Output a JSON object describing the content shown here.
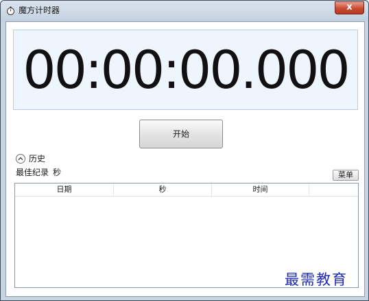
{
  "window": {
    "title": "魔方计时器",
    "close_symbol": "x"
  },
  "timer": {
    "display": "00:00:00.000"
  },
  "controls": {
    "start_label": "开始",
    "menu_label": "菜单"
  },
  "history": {
    "toggle_label": "历史",
    "best_label": "最佳纪录",
    "best_value": "秒",
    "columns": [
      "日期",
      "秒",
      "时间",
      ""
    ],
    "rows": []
  },
  "watermark": {
    "text": "最需教育"
  },
  "colors": {
    "timer_panel_bg": "#eef5fc",
    "close_button": "#c94a32",
    "watermark": "#1f2bb5"
  }
}
